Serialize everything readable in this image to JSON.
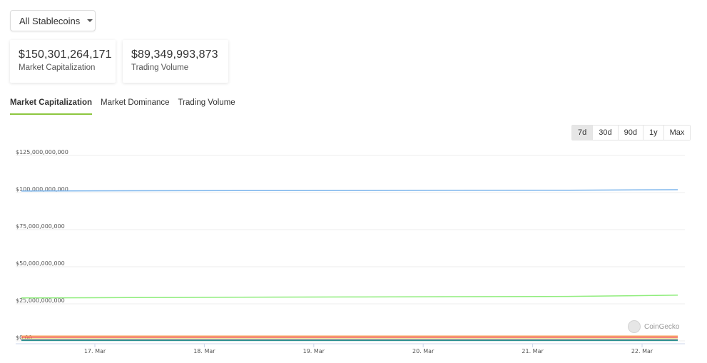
{
  "selector": {
    "label": "All Stablecoins"
  },
  "stats": {
    "market_cap": {
      "value": "$150,301,264,171",
      "label": "Market Capitalization"
    },
    "trading_volume": {
      "value": "$89,349,993,873",
      "label": "Trading Volume"
    }
  },
  "tabs": [
    {
      "label": "Market Capitalization",
      "active": true
    },
    {
      "label": "Market Dominance",
      "active": false
    },
    {
      "label": "Trading Volume",
      "active": false
    }
  ],
  "ranges": [
    {
      "label": "7d",
      "active": true
    },
    {
      "label": "30d",
      "active": false
    },
    {
      "label": "90d",
      "active": false
    },
    {
      "label": "1y",
      "active": false
    },
    {
      "label": "Max",
      "active": false
    }
  ],
  "watermark": "CoinGecko",
  "colors": {
    "accent": "#8dc63f"
  },
  "chart_data": {
    "type": "line",
    "x": [
      "17. Mar",
      "18. Mar",
      "19. Mar",
      "20. Mar",
      "21. Mar",
      "22. Mar"
    ],
    "ylim": [
      0,
      125000000000
    ],
    "y_ticks": [
      "$0.00",
      "$25,000,000,000",
      "$50,000,000,000",
      "$75,000,000,000",
      "$100,000,000,000",
      "$125,000,000,000"
    ],
    "grid": true,
    "series": [
      {
        "color": "#7cb5ec",
        "values": [
          101000000000,
          101200000000,
          101300000000,
          101400000000,
          101500000000,
          101600000000,
          101900000000
        ]
      },
      {
        "color": "#90ed7d",
        "values": [
          29000000000,
          29200000000,
          29400000000,
          29600000000,
          29800000000,
          30000000000,
          30800000000
        ]
      },
      {
        "color": "#f7a35c",
        "values": [
          3200000000,
          3200000000,
          3200000000,
          3200000000,
          3200000000,
          3200000000,
          3200000000
        ]
      },
      {
        "color": "#f45b5b",
        "values": [
          2400000000,
          2400000000,
          2400000000,
          2400000000,
          2400000000,
          2400000000,
          2400000000
        ]
      },
      {
        "color": "#e4d354",
        "values": [
          1300000000,
          1300000000,
          1300000000,
          1300000000,
          1300000000,
          1300000000,
          1300000000
        ]
      },
      {
        "color": "#8085e9",
        "values": [
          700000000,
          700000000,
          700000000,
          700000000,
          700000000,
          700000000,
          700000000
        ]
      },
      {
        "color": "#2b908f",
        "values": [
          300000000,
          300000000,
          300000000,
          300000000,
          300000000,
          300000000,
          300000000
        ]
      }
    ]
  }
}
